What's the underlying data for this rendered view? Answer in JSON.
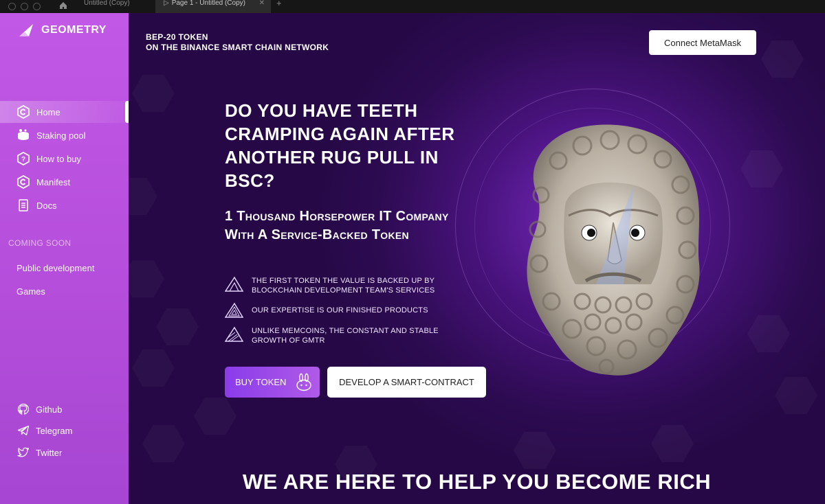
{
  "chrome": {
    "tab1": "Untitled (Copy)",
    "tab2": "Page 1 - Untitled (Copy)",
    "close_glyph": "✕",
    "plus_glyph": "+"
  },
  "sidebar": {
    "brand": "GEOMETRY",
    "items": [
      {
        "label": "Home",
        "icon": "home-icon"
      },
      {
        "label": "Staking pool",
        "icon": "staking-icon"
      },
      {
        "label": "How to buy",
        "icon": "how-to-buy-icon"
      },
      {
        "label": "Manifest",
        "icon": "manifest-icon"
      },
      {
        "label": "Docs",
        "icon": "docs-icon"
      }
    ],
    "coming_soon": "COMING SOON",
    "sub_items": [
      "Public development",
      "Games"
    ],
    "social": [
      {
        "label": "Github",
        "icon": "github-icon"
      },
      {
        "label": "Telegram",
        "icon": "telegram-icon"
      },
      {
        "label": "Twitter",
        "icon": "twitter-icon"
      }
    ]
  },
  "header": {
    "token_line1": "BEP-20 TOKEN",
    "token_line2": "ON THE BINANCE SMART CHAIN NETWORK",
    "connect_label": "Connect MetaMask"
  },
  "hero": {
    "title": "DO YOU HAVE TEETH CRAMPING AGAIN AFTER ANOTHER RUG PULL IN BSC?",
    "subtitle": "1 Thousand Horsepower IT Company With A Service-Backed Token",
    "features": [
      "THE FIRST TOKEN THE VALUE IS BACKED UP BY BLOCKCHAIN DEVELOPMENT TEAM'S SERVICES",
      "OUR EXPERTISE IS OUR FINISHED PRODUCTS",
      "UNLIKE MEMCOINS, THE CONSTANT AND STABLE GROWTH OF GMTR"
    ],
    "buy_label": "BUY TOKEN",
    "develop_label": "DEVELOP A SMART-CONTRACT"
  },
  "section": {
    "title": "WE ARE HERE TO HELP YOU BECOME RICH"
  },
  "colors": {
    "sidebar": "#b64fdc",
    "main_bg": "#2d0b52",
    "accent": "#8a3cea"
  }
}
